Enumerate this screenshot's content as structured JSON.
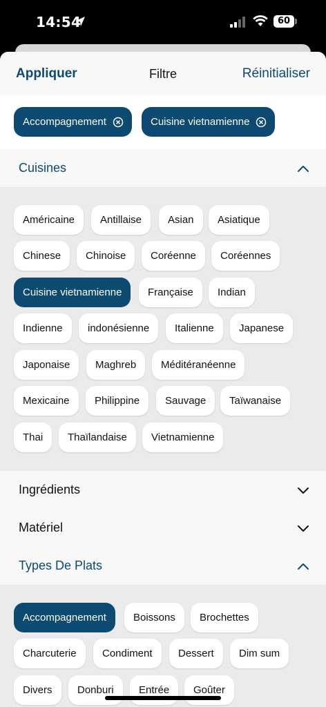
{
  "status_bar": {
    "time": "14:54",
    "battery": "60"
  },
  "nav": {
    "apply": "Appliquer",
    "title": "Filtre",
    "reset": "Réinitialiser"
  },
  "active_filters": [
    "Accompagnement",
    "Cuisine vietnamienne"
  ],
  "sections": {
    "cuisines": {
      "label": "Cuisines",
      "expanded": true,
      "chips": [
        "Américaine",
        "Antillaise",
        "Asian",
        "Asiatique",
        "Chinese",
        "Chinoise",
        "Coréenne",
        "Coréennes",
        "Cuisine vietnamienne",
        "Française",
        "Indian",
        "Indienne",
        "indonésienne",
        "Italienne",
        "Japanese",
        "Japonaise",
        "Maghreb",
        "Méditéranéenne",
        "Mexicaine",
        "Philippine",
        "Sauvage",
        "Taïwanaise",
        "Thai",
        "Thaïlandaise",
        "Vietnamienne"
      ],
      "selected": [
        "Cuisine vietnamienne"
      ]
    },
    "ingredients": {
      "label": "Ingrédients",
      "expanded": false
    },
    "materiel": {
      "label": "Matériel",
      "expanded": false
    },
    "types": {
      "label": "Types De Plats",
      "expanded": true,
      "chips": [
        "Accompagnement",
        "Boissons",
        "Brochettes",
        "Charcuterie",
        "Condiment",
        "Dessert",
        "Dim sum",
        "Divers",
        "Donburi",
        "Entrée",
        "Goûter"
      ],
      "selected": [
        "Accompagnement"
      ]
    }
  },
  "colors": {
    "accent": "#0d4a72",
    "chip_bg": "#ffffff",
    "area_bg": "#ebebeb",
    "header_bg": "#f8f8f8"
  },
  "icons": {
    "location": "location-arrow-icon",
    "signal": "cellular-signal-icon",
    "wifi": "wifi-icon",
    "remove": "circle-x-icon",
    "expand": "chevron-down-icon",
    "collapse": "chevron-up-icon"
  }
}
